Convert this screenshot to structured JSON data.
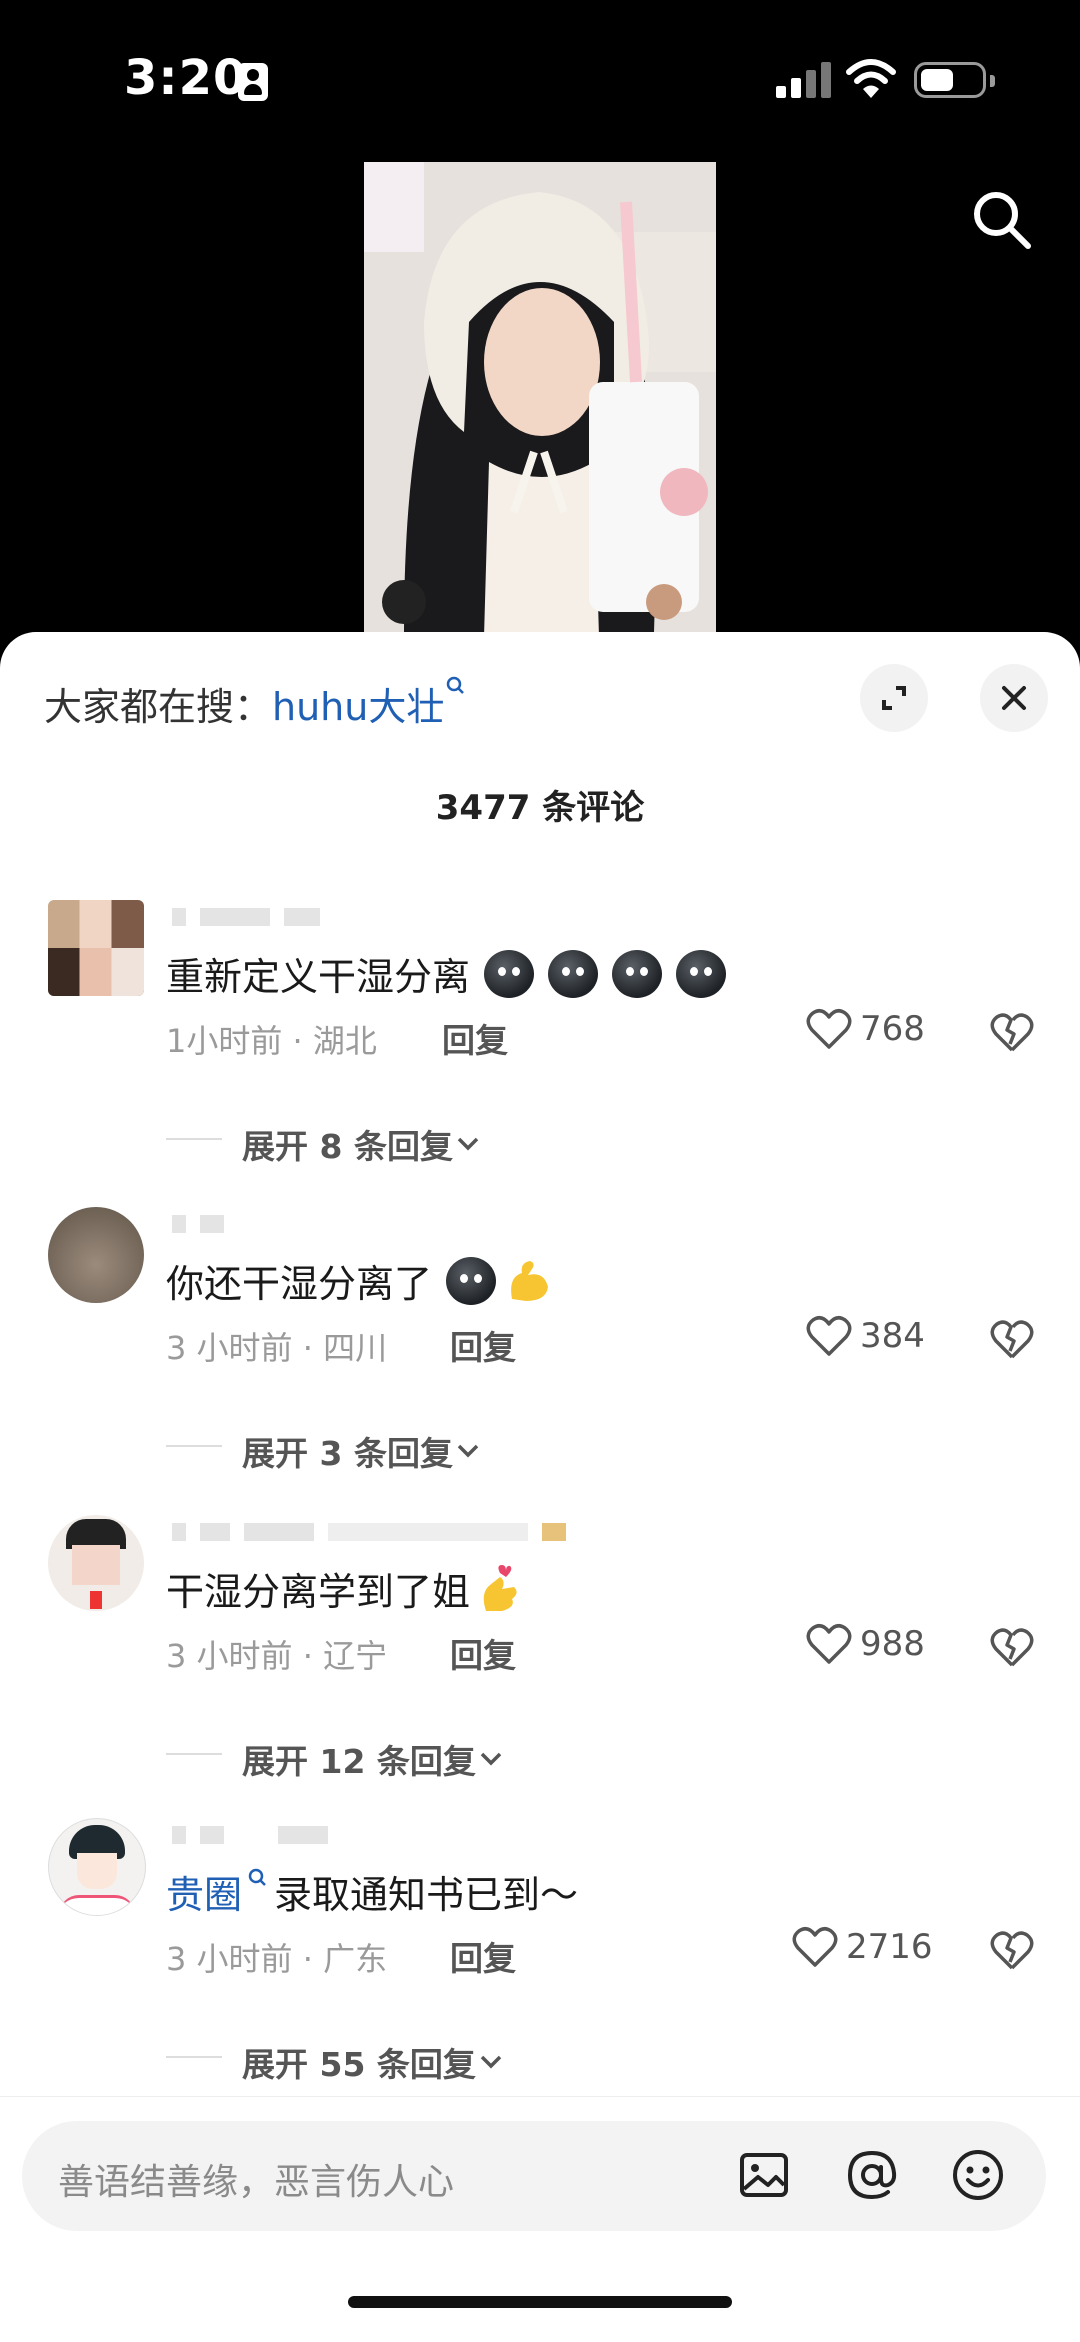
{
  "status_bar": {
    "time": "3:20"
  },
  "header": {
    "prefix": "大家都在搜：",
    "link": "huhu大壮"
  },
  "comments_count": "3477 条评论",
  "comments": [
    {
      "text": "重新定义干湿分离",
      "emoji_count": 4,
      "time": "1小时前",
      "location": "湖北",
      "reply_label": "回复",
      "likes": "768",
      "expand_label": "展开 8 条回复"
    },
    {
      "text": "你还干湿分离了",
      "time": "3 小时前",
      "location": "四川",
      "reply_label": "回复",
      "likes": "384",
      "expand_label": "展开 3 条回复"
    },
    {
      "text": "干湿分离学到了姐",
      "time": "3 小时前",
      "location": "辽宁",
      "reply_label": "回复",
      "likes": "988",
      "expand_label": "展开 12 条回复"
    },
    {
      "tag": "贵圈",
      "text": "录取通知书已到～",
      "time": "3 小时前",
      "location": "广东",
      "reply_label": "回复",
      "likes": "2716",
      "expand_label": "展开 55 条回复"
    }
  ],
  "input": {
    "placeholder": "善语结善缘，恶言伤人心"
  },
  "icons": [
    "search-icon",
    "expand-icon",
    "close-icon",
    "heart-icon",
    "broken-heart-icon",
    "chevron-down-icon",
    "image-icon",
    "at-icon",
    "smiley-icon"
  ]
}
